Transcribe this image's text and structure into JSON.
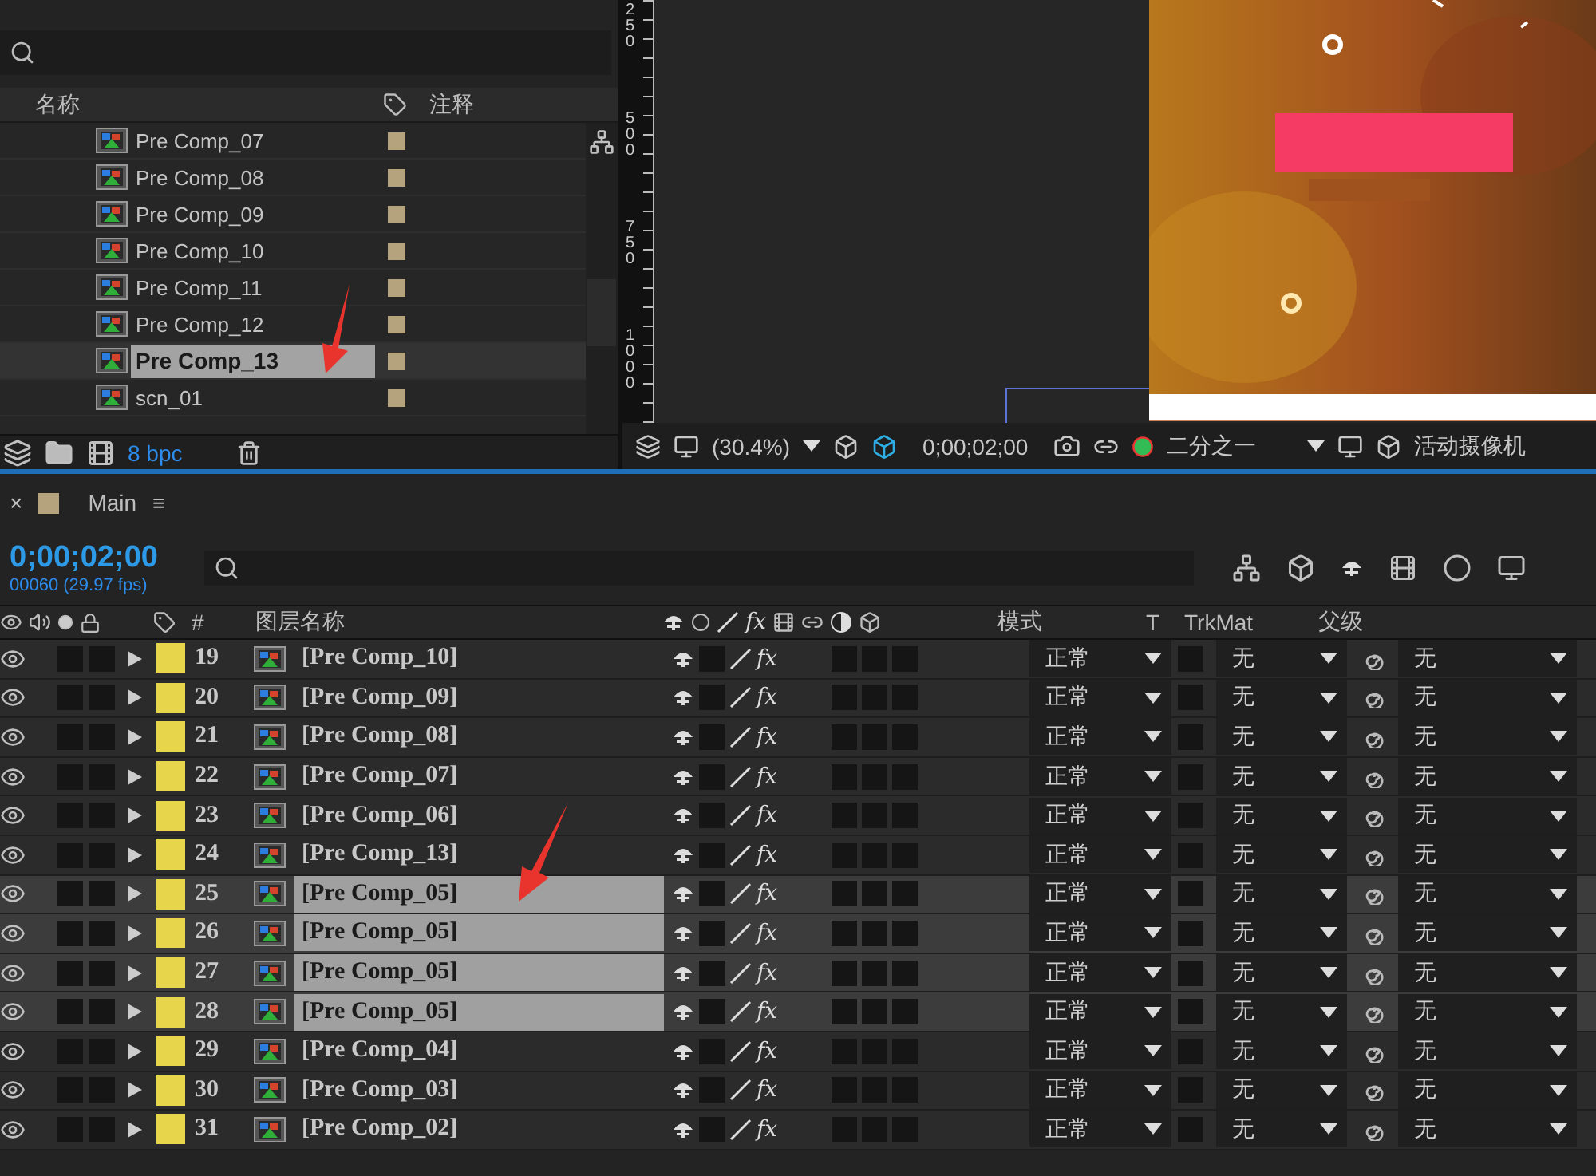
{
  "project_panel": {
    "columns": [
      "名称",
      "注释"
    ],
    "items": [
      {
        "name": "Pre Comp_07",
        "selected": false
      },
      {
        "name": "Pre Comp_08",
        "selected": false
      },
      {
        "name": "Pre Comp_09",
        "selected": false
      },
      {
        "name": "Pre Comp_10",
        "selected": false
      },
      {
        "name": "Pre Comp_11",
        "selected": false
      },
      {
        "name": "Pre Comp_12",
        "selected": false
      },
      {
        "name": "Pre Comp_13",
        "selected": true
      },
      {
        "name": "scn_01",
        "selected": false
      }
    ],
    "bit_depth": "8 bpc"
  },
  "viewer": {
    "ruler_labels": [
      "250",
      "500",
      "750",
      "1000"
    ],
    "zoom": "(30.4%)",
    "timecode": "0;00;02;00",
    "resolution": "二分之一",
    "camera": "活动摄像机"
  },
  "timeline": {
    "close": "×",
    "tab": "Main",
    "menu": "≡",
    "timecode": "0;00;02;00",
    "frame_info": "00060 (29.97 fps)",
    "columns": {
      "number": "#",
      "name": "图层名称",
      "fx": "fx",
      "mode": "模式",
      "t": "T",
      "trkmat": "TrkMat",
      "parent": "父级"
    },
    "layers": [
      {
        "number": "19",
        "name": "[Pre Comp_10]",
        "selected": false,
        "fx": "fx",
        "mode": "正常",
        "trkmat": "无",
        "parent": "无"
      },
      {
        "number": "20",
        "name": "[Pre Comp_09]",
        "selected": false,
        "fx": "fx",
        "mode": "正常",
        "trkmat": "无",
        "parent": "无"
      },
      {
        "number": "21",
        "name": "[Pre Comp_08]",
        "selected": false,
        "fx": "fx",
        "mode": "正常",
        "trkmat": "无",
        "parent": "无"
      },
      {
        "number": "22",
        "name": "[Pre Comp_07]",
        "selected": false,
        "fx": "fx",
        "mode": "正常",
        "trkmat": "无",
        "parent": "无"
      },
      {
        "number": "23",
        "name": "[Pre Comp_06]",
        "selected": false,
        "fx": "fx",
        "mode": "正常",
        "trkmat": "无",
        "parent": "无"
      },
      {
        "number": "24",
        "name": "[Pre Comp_13]",
        "selected": false,
        "fx": "fx",
        "mode": "正常",
        "trkmat": "无",
        "parent": "无"
      },
      {
        "number": "25",
        "name": "[Pre Comp_05]",
        "selected": true,
        "fx": "fx",
        "mode": "正常",
        "trkmat": "无",
        "parent": "无"
      },
      {
        "number": "26",
        "name": "[Pre Comp_05]",
        "selected": true,
        "fx": "fx",
        "mode": "正常",
        "trkmat": "无",
        "parent": "无"
      },
      {
        "number": "27",
        "name": "[Pre Comp_05]",
        "selected": true,
        "fx": "fx",
        "mode": "正常",
        "trkmat": "无",
        "parent": "无"
      },
      {
        "number": "28",
        "name": "[Pre Comp_05]",
        "selected": true,
        "fx": "fx",
        "mode": "正常",
        "trkmat": "无",
        "parent": "无"
      },
      {
        "number": "29",
        "name": "[Pre Comp_04]",
        "selected": false,
        "fx": "fx",
        "mode": "正常",
        "trkmat": "无",
        "parent": "无"
      },
      {
        "number": "30",
        "name": "[Pre Comp_03]",
        "selected": false,
        "fx": "fx",
        "mode": "正常",
        "trkmat": "无",
        "parent": "无"
      },
      {
        "number": "31",
        "name": "[Pre Comp_02]",
        "selected": false,
        "fx": "fx",
        "mode": "正常",
        "trkmat": "无",
        "parent": "无"
      }
    ]
  }
}
